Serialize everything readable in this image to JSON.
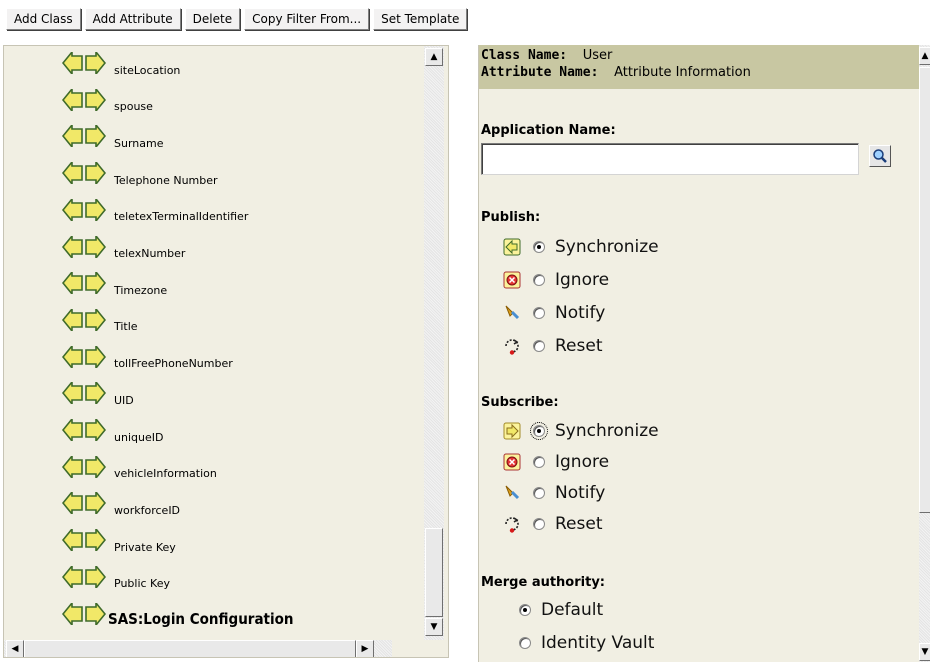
{
  "toolbar": {
    "buttons": [
      "Add Class",
      "Add Attribute",
      "Delete",
      "Copy Filter From...",
      "Set Template"
    ]
  },
  "attribute_list": {
    "items": [
      {
        "label": "siteLocation"
      },
      {
        "label": "spouse"
      },
      {
        "label": "Surname"
      },
      {
        "label": "Telephone Number"
      },
      {
        "label": "teletexTerminalIdentifier"
      },
      {
        "label": "telexNumber"
      },
      {
        "label": "Timezone"
      },
      {
        "label": "Title"
      },
      {
        "label": "tollFreePhoneNumber"
      },
      {
        "label": "UID"
      },
      {
        "label": "uniqueID"
      },
      {
        "label": "vehicleInformation"
      },
      {
        "label": "workforceID"
      },
      {
        "label": "Private Key"
      },
      {
        "label": "Public Key"
      },
      {
        "label": "SAS:Login Configuration",
        "selected": true
      }
    ],
    "icon": "sync-both-arrows-icon"
  },
  "details": {
    "class_key": "Class Name:",
    "class_value": "User",
    "attr_key": "Attribute Name:",
    "attr_value": "Attribute Information",
    "app_name_label": "Application Name:",
    "app_name_value": "",
    "publish_label": "Publish:",
    "publish_options": [
      {
        "label": "Synchronize",
        "icon": "publish-sync-arrow-icon",
        "checked": true
      },
      {
        "label": "Ignore",
        "icon": "publish-ignore-icon",
        "checked": false
      },
      {
        "label": "Notify",
        "icon": "bell-notify-icon",
        "checked": false
      },
      {
        "label": "Reset",
        "icon": "reset-icon",
        "checked": false
      }
    ],
    "subscribe_label": "Subscribe:",
    "subscribe_options": [
      {
        "label": "Synchronize",
        "icon": "subscribe-sync-arrow-icon",
        "checked": true
      },
      {
        "label": "Ignore",
        "icon": "subscribe-ignore-icon",
        "checked": false
      },
      {
        "label": "Notify",
        "icon": "bell-notify-icon",
        "checked": false
      },
      {
        "label": "Reset",
        "icon": "reset-icon",
        "checked": false
      }
    ],
    "merge_label": "Merge authority:",
    "merge_options": [
      {
        "label": "Default",
        "checked": true
      },
      {
        "label": "Identity Vault",
        "checked": false
      }
    ]
  },
  "colors": {
    "pane_bg": "#f1efe3",
    "header_bg": "#c8c7a2",
    "arrow_fill": "#f1e868",
    "arrow_stroke": "#3f6b2a"
  }
}
